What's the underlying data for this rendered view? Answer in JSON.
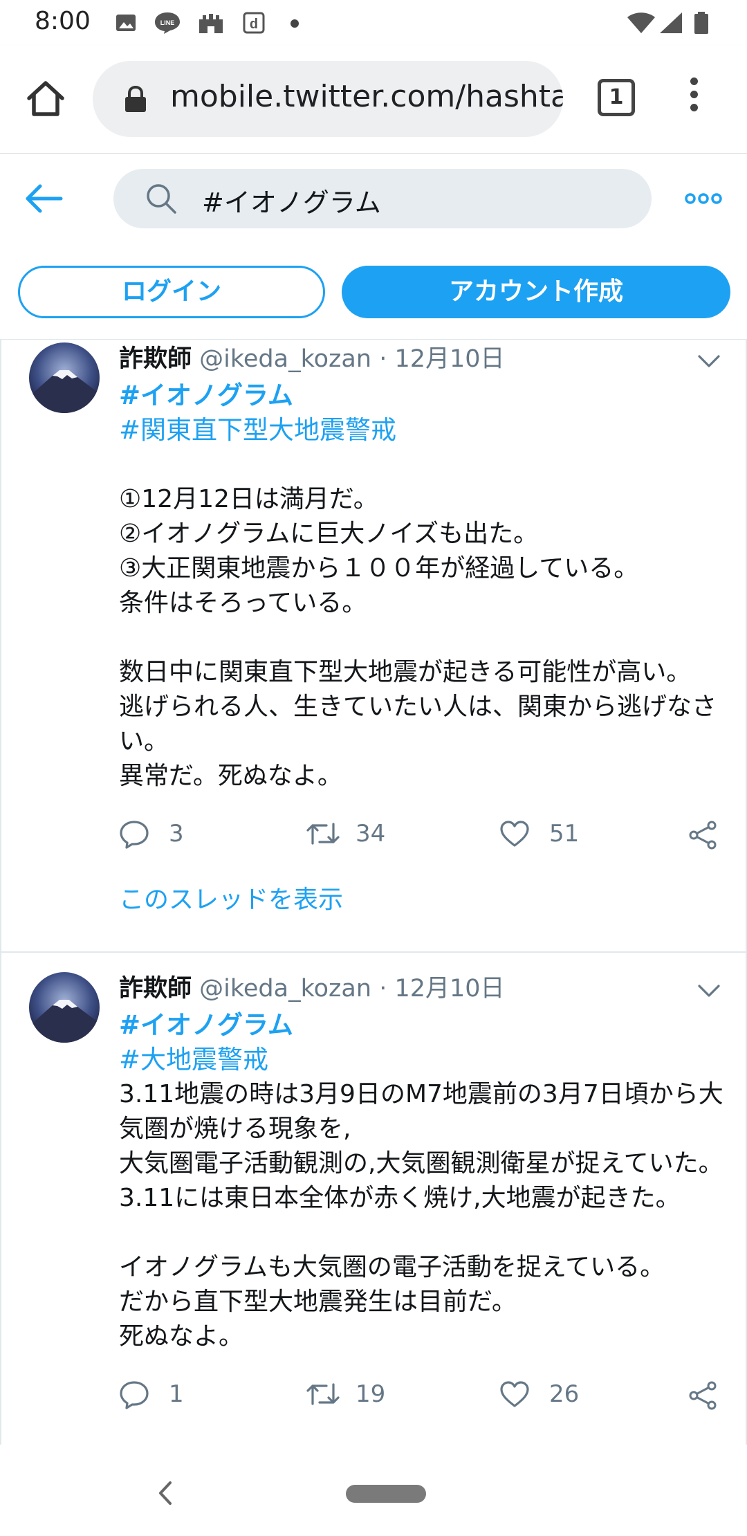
{
  "status_bar": {
    "time": "8:00",
    "icons": [
      "image-icon",
      "line-icon",
      "castle-icon",
      "d-icon",
      "dot-icon",
      "wifi-icon",
      "signal-icon",
      "battery-icon"
    ]
  },
  "browser": {
    "url": "mobile.twitter.com/hashtag",
    "tab_count": "1"
  },
  "header": {
    "search_query": "#イオノグラム"
  },
  "auth": {
    "login_label": "ログイン",
    "signup_label": "アカウント作成"
  },
  "colors": {
    "accent": "#1da1f2",
    "secondary_text": "#657786"
  },
  "tweets": [
    {
      "name": "詐欺師",
      "handle": "@ikeda_kozan",
      "separator": "·",
      "date": "12月10日",
      "hashtag_primary": "#イオノグラム",
      "hashtag_secondary": "#関東直下型大地震警戒",
      "text": "\n①12月12日は満月だ。\n②イオノグラムに巨大ノイズも出た。\n③大正関東地震から１００年が経過している。\n条件はそろっている。\n\n数日中に関東直下型大地震が起きる可能性が高い。\n逃げられる人、生きていたい人は、関東から逃げなさい。\n異常だ。死ぬなよ。",
      "replies": "3",
      "retweets": "34",
      "likes": "51",
      "thread_link": "このスレッドを表示"
    },
    {
      "name": "詐欺師",
      "handle": "@ikeda_kozan",
      "separator": "·",
      "date": "12月10日",
      "hashtag_primary": "#イオノグラム",
      "hashtag_secondary": "#大地震警戒",
      "text": "3.11地震の時は3月9日のM7地震前の3月7日頃から大気圏が焼ける現象を,\n大気圏電子活動観測の,大気圏観測衛星が捉えていた。\n3.11には東日本全体が赤く焼け,大地震が起きた。\n\nイオノグラムも大気圏の電子活動を捉えている。\nだから直下型大地震発生は目前だ。\n死ぬなよ。",
      "replies": "1",
      "retweets": "19",
      "likes": "26"
    }
  ]
}
